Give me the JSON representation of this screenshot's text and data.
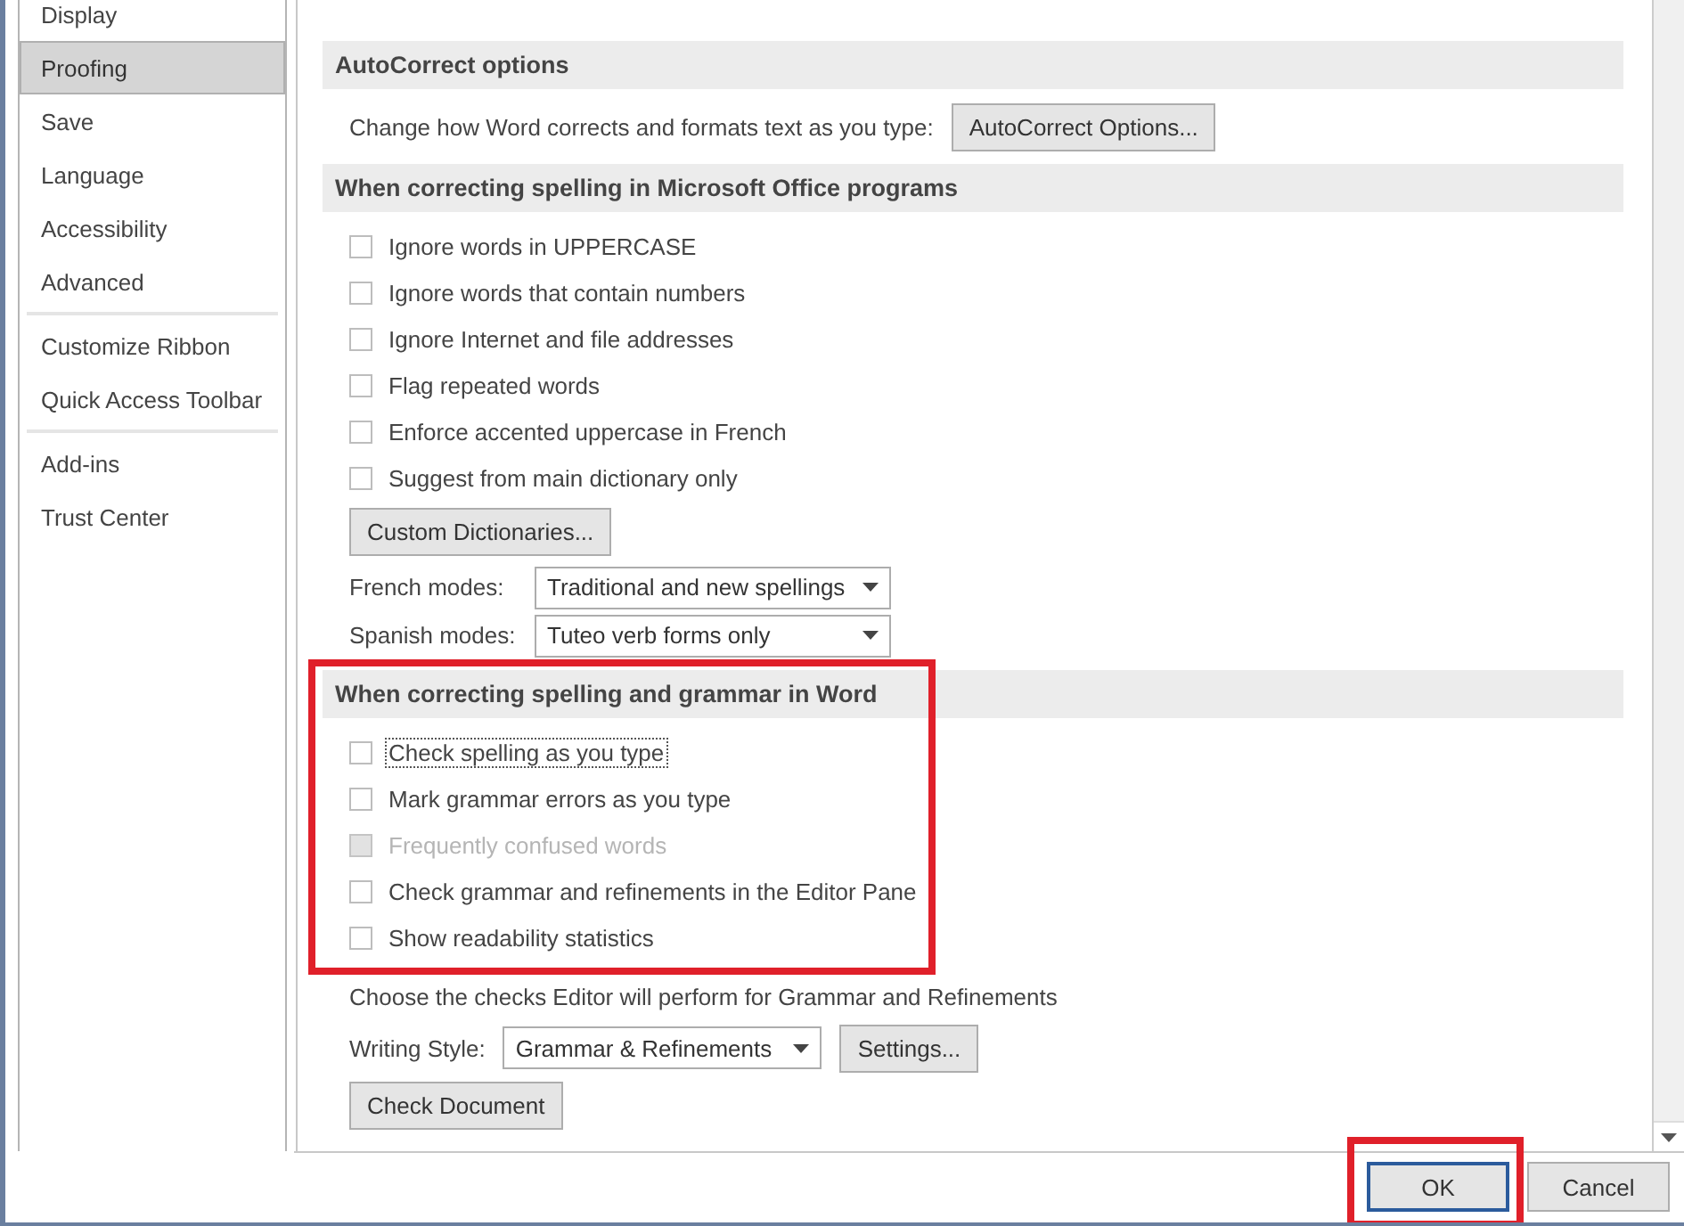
{
  "sidebar": {
    "items": [
      {
        "label": "Display",
        "selected": false,
        "separator_after": false
      },
      {
        "label": "Proofing",
        "selected": true,
        "separator_after": false
      },
      {
        "label": "Save",
        "selected": false,
        "separator_after": false
      },
      {
        "label": "Language",
        "selected": false,
        "separator_after": false
      },
      {
        "label": "Accessibility",
        "selected": false,
        "separator_after": false
      },
      {
        "label": "Advanced",
        "selected": false,
        "separator_after": true
      },
      {
        "label": "Customize Ribbon",
        "selected": false,
        "separator_after": false
      },
      {
        "label": "Quick Access Toolbar",
        "selected": false,
        "separator_after": true
      },
      {
        "label": "Add-ins",
        "selected": false,
        "separator_after": false
      },
      {
        "label": "Trust Center",
        "selected": false,
        "separator_after": false
      }
    ]
  },
  "sections": [
    {
      "heading": "AutoCorrect options",
      "highlighted": false,
      "rows": [
        {
          "kind": "text_button",
          "text": "Change how Word corrects and formats text as you type:",
          "button": "AutoCorrect Options..."
        }
      ]
    },
    {
      "heading": "When correcting spelling in Microsoft Office programs",
      "highlighted": false,
      "rows": [
        {
          "kind": "checkbox",
          "label": "Ignore words in UPPERCASE",
          "checked": false,
          "disabled": false,
          "focused": false
        },
        {
          "kind": "checkbox",
          "label": "Ignore words that contain numbers",
          "checked": false,
          "disabled": false,
          "focused": false
        },
        {
          "kind": "checkbox",
          "label": "Ignore Internet and file addresses",
          "checked": false,
          "disabled": false,
          "focused": false
        },
        {
          "kind": "checkbox",
          "label": "Flag repeated words",
          "checked": false,
          "disabled": false,
          "focused": false
        },
        {
          "kind": "checkbox",
          "label": "Enforce accented uppercase in French",
          "checked": false,
          "disabled": false,
          "focused": false
        },
        {
          "kind": "checkbox",
          "label": "Suggest from main dictionary only",
          "checked": false,
          "disabled": false,
          "focused": false
        },
        {
          "kind": "button",
          "label": "Custom Dictionaries..."
        },
        {
          "kind": "dropdown",
          "label": "French modes:",
          "value": "Traditional and new spellings"
        },
        {
          "kind": "dropdown",
          "label": "Spanish modes:",
          "value": "Tuteo verb forms only"
        }
      ]
    },
    {
      "heading": "When correcting spelling and grammar in Word",
      "highlighted": true,
      "rows": [
        {
          "kind": "checkbox",
          "label": "Check spelling as you type",
          "checked": false,
          "disabled": false,
          "focused": true
        },
        {
          "kind": "checkbox",
          "label": "Mark grammar errors as you type",
          "checked": false,
          "disabled": false,
          "focused": false
        },
        {
          "kind": "checkbox",
          "label": "Frequently confused words",
          "checked": false,
          "disabled": true,
          "focused": false
        },
        {
          "kind": "checkbox",
          "label": "Check grammar and refinements in the Editor Pane",
          "checked": false,
          "disabled": false,
          "focused": false
        },
        {
          "kind": "checkbox",
          "label": "Show readability statistics",
          "checked": false,
          "disabled": false,
          "focused": false
        },
        {
          "kind": "note",
          "text": "Choose the checks Editor will perform for Grammar and Refinements"
        },
        {
          "kind": "dropdown_button",
          "label": "Writing Style:",
          "value": "Grammar & Refinements",
          "button": "Settings..."
        },
        {
          "kind": "button",
          "label": "Check Document"
        }
      ]
    }
  ],
  "buttons": [
    {
      "label": "OK",
      "default": true,
      "highlighted": true
    },
    {
      "label": "Cancel",
      "default": false,
      "highlighted": false
    }
  ]
}
